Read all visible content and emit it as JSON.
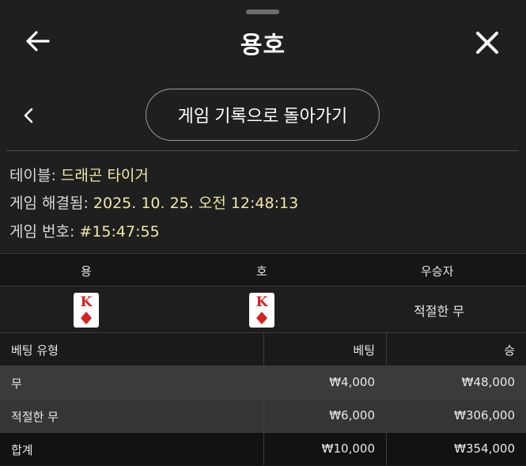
{
  "header": {
    "title": "용호"
  },
  "nav": {
    "return_label": "게임 기록으로 돌아가기"
  },
  "info": {
    "table_label": "테이블: ",
    "table_value": "드래곤 타이거",
    "resolved_label": "게임 해결됨: ",
    "resolved_value": "2025. 10. 25. 오전 12:48:13",
    "number_label": "게임 번호: ",
    "number_value": "#15:47:55"
  },
  "result": {
    "col_dragon": "용",
    "col_tiger": "호",
    "col_winner": "우승자",
    "dragon_card": {
      "rank": "K",
      "suit": "diamonds"
    },
    "tiger_card": {
      "rank": "K",
      "suit": "diamonds"
    },
    "winner": "적절한 무"
  },
  "bets": {
    "headers": {
      "type": "베팅 유형",
      "bet": "베팅",
      "win": "승"
    },
    "rows": [
      {
        "type": "무",
        "bet": "₩4,000",
        "win": "₩48,000"
      },
      {
        "type": "적절한 무",
        "bet": "₩6,000",
        "win": "₩306,000"
      }
    ],
    "total": {
      "type": "합계",
      "bet": "₩10,000",
      "win": "₩354,000"
    }
  },
  "colors": {
    "accent_text": "#f1e7a8",
    "card_red": "#d42222",
    "background": "#1f1f1f"
  }
}
